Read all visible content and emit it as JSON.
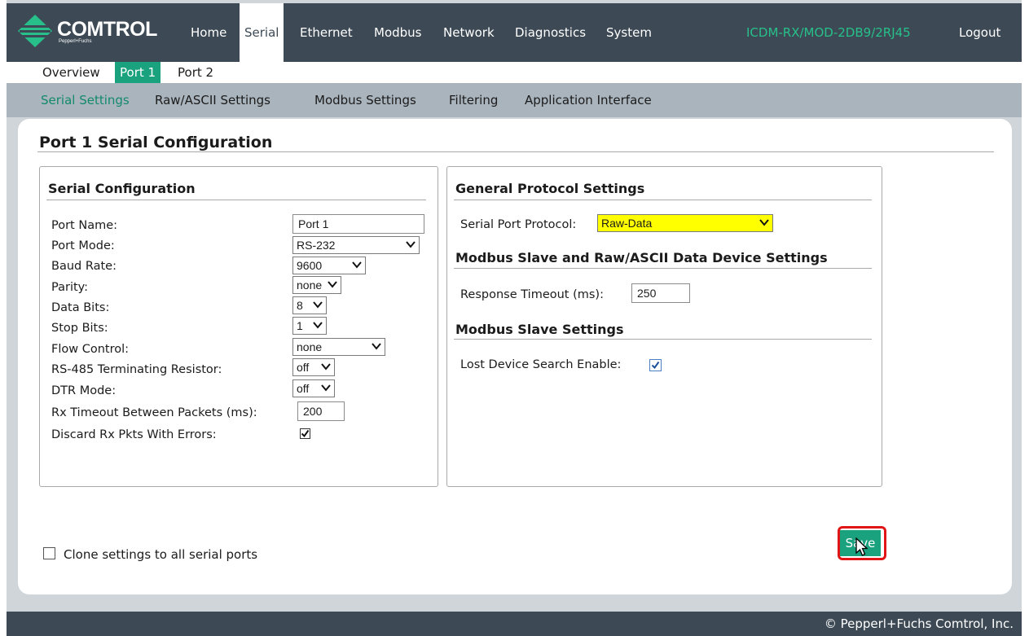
{
  "brand": {
    "name": "COMTROL",
    "sub": "Pepperl+Fuchs"
  },
  "nav": {
    "items": [
      "Home",
      "Serial",
      "Ethernet",
      "Modbus",
      "Network",
      "Diagnostics",
      "System"
    ],
    "active": "Serial",
    "device": "ICDM-RX/MOD-2DB9/2RJ45",
    "logout": "Logout"
  },
  "subnav": {
    "items": [
      "Overview",
      "Port 1",
      "Port 2"
    ],
    "active": "Port 1"
  },
  "thirdnav": {
    "items": [
      "Serial Settings",
      "Raw/ASCII Settings",
      "Modbus Settings",
      "Filtering",
      "Application Interface"
    ],
    "active": "Serial Settings"
  },
  "page": {
    "title": "Port 1 Serial Configuration"
  },
  "serial": {
    "title": "Serial Configuration",
    "fields": [
      {
        "label": "Port Name:",
        "value": "Port 1",
        "kind": "text"
      },
      {
        "label": "Port Mode:",
        "value": "RS-232",
        "kind": "select"
      },
      {
        "label": "Baud Rate:",
        "value": "9600",
        "kind": "select"
      },
      {
        "label": "Parity:",
        "value": "none",
        "kind": "select"
      },
      {
        "label": "Data Bits:",
        "value": "8",
        "kind": "select"
      },
      {
        "label": "Stop Bits:",
        "value": "1",
        "kind": "select"
      },
      {
        "label": "Flow Control:",
        "value": "none",
        "kind": "select"
      },
      {
        "label": "RS-485 Terminating Resistor:",
        "value": "off",
        "kind": "select"
      },
      {
        "label": "DTR Mode:",
        "value": "off",
        "kind": "select"
      },
      {
        "label": "Rx Timeout Between Packets (ms):",
        "value": "200",
        "kind": "text"
      },
      {
        "label": "Discard Rx Pkts With Errors:",
        "value": true,
        "kind": "checkbox"
      }
    ]
  },
  "protocol": {
    "title": "General Protocol Settings",
    "protocol_label": "Serial Port Protocol:",
    "protocol_value": "Raw-Data",
    "protocol_highlight": "#ffff00",
    "modbus_raw_title": "Modbus Slave and Raw/ASCII Data Device Settings",
    "timeout_label": "Response Timeout (ms):",
    "timeout_value": "250",
    "modbus_slave_title": "Modbus Slave Settings",
    "lost_label": "Lost Device Search Enable:",
    "lost_checked": true
  },
  "clone": {
    "label": "Clone settings to all serial ports",
    "checked": false
  },
  "save": {
    "label": "Save",
    "color": "#1aa17e",
    "highlight_color": "#e01616"
  },
  "footer": {
    "text": "© Pepperl+Fuchs Comtrol, Inc."
  }
}
